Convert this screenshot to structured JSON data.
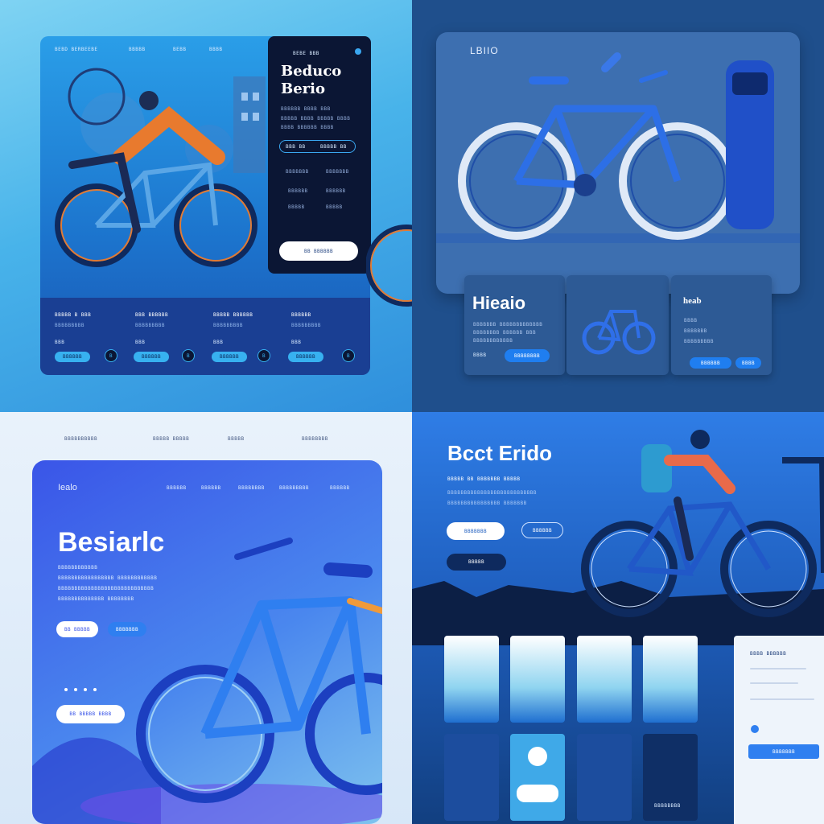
{
  "q1": {
    "nav": [
      "BEBD BERBEEBE",
      "BBBBB",
      "BEBB",
      "BBBB"
    ],
    "brand_title": "Beduco",
    "brand_subtitle": "Berio",
    "tagline_top": "BEBE BBB",
    "desc": [
      "BBBBBB BBBB BBB",
      "BBBBB BBBB BBBBB BBBB",
      "BBBB BBBBBB BBBB"
    ],
    "toggle_left": "BBB BB",
    "toggle_right": "BBBBB BB",
    "stats_row1": [
      "BBBBBBB",
      "BBBBBBB"
    ],
    "stats_row2": [
      "BBBBBB",
      "BBBBBB"
    ],
    "stats_row3": [
      "BBBBB"
    ],
    "cta_label": "BB  BBBBBB",
    "cards": [
      {
        "title": "BBBBB B BBB",
        "sub": "BBBBBBBBB",
        "tag": "BBB",
        "btn": "BBBBBB",
        "icon": "B"
      },
      {
        "title": "BBB BBBBBB",
        "sub": "BBBBBBBBB",
        "tag": "BBB",
        "btn": "BBBBBB",
        "icon": "B"
      },
      {
        "title": "BBBBB BBBBBB",
        "sub": "BBBBBBBBB",
        "tag": "BBB",
        "btn": "BBBBBB",
        "icon": "B"
      },
      {
        "title": "BBBBBB",
        "sub": "BBBBBBBBB",
        "tag": "BBB",
        "btn": "BBBBBB",
        "icon": "B"
      }
    ]
  },
  "q2": {
    "logo": "LBIIO",
    "heading": "Hieaio",
    "card_small_title": "heab",
    "card_left_desc": [
      "BBBBBBB BBBBBBBBBBBBB",
      "BBBBBBBB BBBBBB BBB",
      "BBBBBBBBBBBB"
    ],
    "card_left_label": "BBBB",
    "card_left_btn": "BBBBBBBB",
    "card_right_rows": [
      "BBBB",
      "BBBBBBB",
      "BBBBBBBBB"
    ],
    "card_right_btns": [
      "BBBBBB",
      "BBBB"
    ]
  },
  "q3": {
    "top_nav": [
      "BBBBBBBBBB",
      "BBBBB BBBBB",
      "BBBBB",
      "BBBBBBBB"
    ],
    "logo": "Iealo",
    "nav": [
      "BBBBBB",
      "BBBBBB",
      "BBBBBBBB",
      "BBBBBBBBB",
      "BBBBBB"
    ],
    "title": "Besiarlc",
    "desc": [
      "BBBBBBBBBBBB",
      "BBBBBBBBBBBBBBBBB BBBBBBBBBBBB",
      "BBBBBBBBBBBBBBBBBBBBBBBBBBBBB",
      "BBBBBBBBBBBBBB BBBBBBBB"
    ],
    "btn_primary": "BB  BBBBB",
    "btn_secondary": "BBBBBBB",
    "btn_bottom": "BB  BBBBB  BBBB"
  },
  "q4": {
    "title": "Bcct Erido",
    "subtitle": "BBBBB BB BBBBBBB BBBBB",
    "desc": [
      "BBBBBBBBBBBBBBBBBBBBBBBBBBB",
      "BBBBBBBBBBBBBBBB BBBBBBB"
    ],
    "btn_primary": "BBBBBBB",
    "btn_outline": "BBBBBB",
    "btn_dark": "BBBBB",
    "side_title": "BBBB BBBBBB",
    "side_btn": "BBBBBBB",
    "card_dark_label": "BBBBBBBB"
  }
}
